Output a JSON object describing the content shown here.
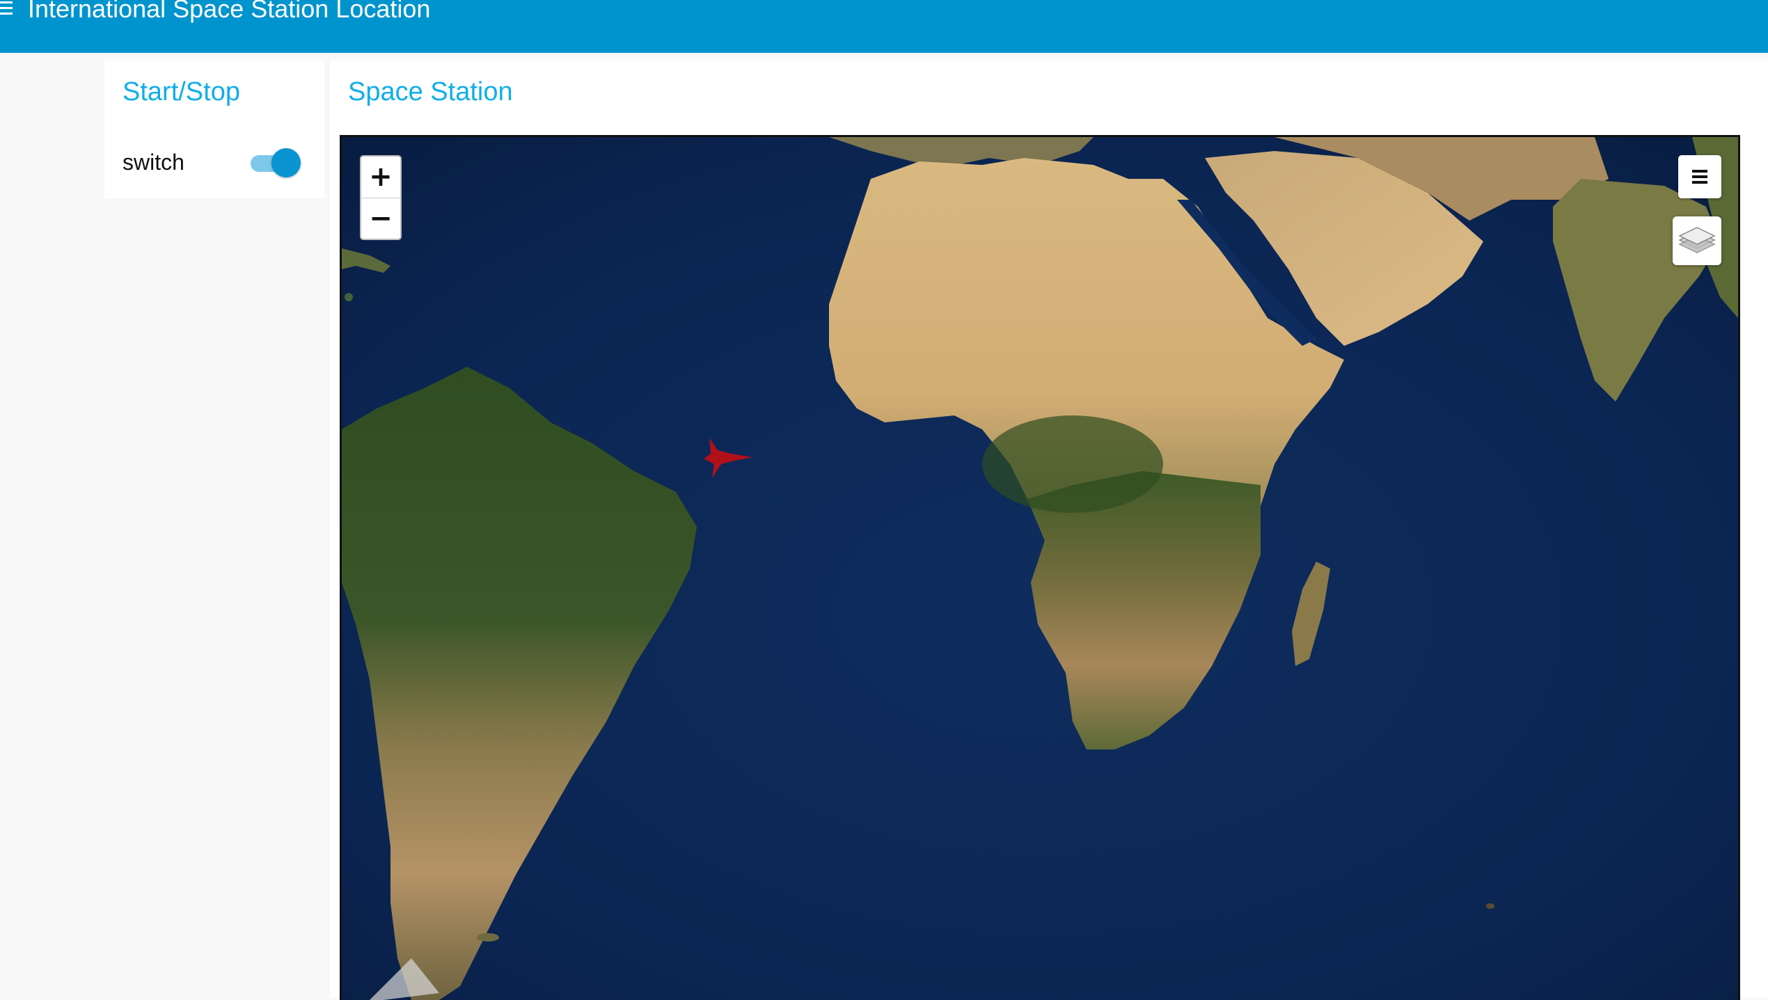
{
  "app": {
    "title": "International Space Station Location",
    "menu_icon": "hamburger-menu-icon",
    "brand_color": "#0094ce"
  },
  "control_panel": {
    "title": "Start/Stop",
    "switch_label": "switch",
    "switch_state": "on",
    "accent_color": "#10aee8"
  },
  "map_panel": {
    "title": "Space Station",
    "zoom_in_label": "+",
    "zoom_out_label": "−",
    "basemap": "satellite imagery",
    "marker_icon": "iss-marker-icon",
    "marker_color": "#b0101a",
    "menu_control_icon": "hamburger-icon",
    "layers_control_icon": "layers-icon"
  }
}
